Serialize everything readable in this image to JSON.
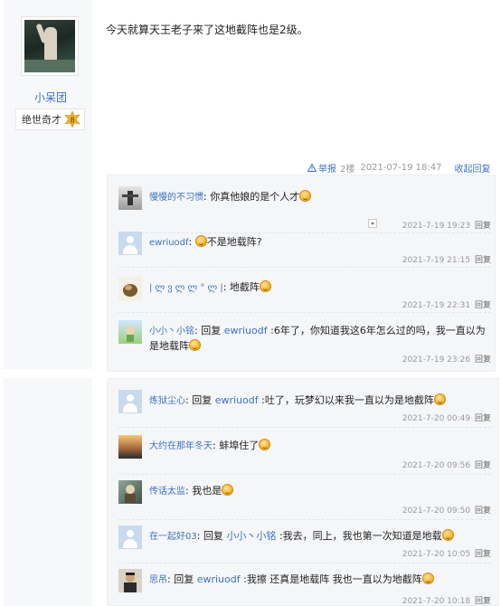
{
  "post": {
    "username": "小呆团",
    "rank_title": "绝世奇才",
    "rank_level": "8",
    "content": "今天就算天王老子来了这地截阵也是2级。",
    "report_label": "举报",
    "floor": "2楼",
    "time": "2021-07-19 18:47",
    "collapse_label": "收起回复"
  },
  "replies_top": [
    {
      "name": "慢慢的不习惯",
      "text": "你真他娘的是个人才",
      "time": "2021-7-19 19:23",
      "reply_label": "回复"
    },
    {
      "name": "ewriuodf",
      "text": "不是地载阵?",
      "time": "2021-7-19 21:15",
      "reply_label": "回复"
    },
    {
      "name": "| ლ ვ ლ ლ ° ლ |",
      "text": "地截阵",
      "time": "2021-7-19 22:31",
      "reply_label": "回复"
    },
    {
      "name": "小小丶小铭",
      "prefix": "回复",
      "ref": "ewriuodf",
      "text": ":6年了，你知道我这6年怎么过的吗，我一直以为是地载阵",
      "time": "2021-7-19 23:26",
      "reply_label": "回复"
    }
  ],
  "replies_bottom": [
    {
      "name": "炼狱尘心",
      "prefix": "回复",
      "ref": "ewriuodf",
      "text": ":吐了，玩梦幻以来我一直以为是地截阵",
      "time": "2021-7-20 00:49",
      "reply_label": "回复"
    },
    {
      "name": "大约在那年冬天",
      "text": "蚌埠住了",
      "time": "2021-7-20 09:56",
      "reply_label": "回复"
    },
    {
      "name": "传话太监",
      "text": "我也是",
      "time": "2021-7-20 09:50",
      "reply_label": "回复"
    },
    {
      "name": "在一起好03",
      "prefix": "回复",
      "ref": "小小丶小铭",
      "text": ":我去，同上，我也第一次知道是地载",
      "time": "2021-7-20 10:05",
      "reply_label": "回复"
    },
    {
      "name": "思吊",
      "prefix": "回复",
      "ref": "ewriuodf",
      "text": ":我擦 还真是地载阵 我也一直以为地截阵",
      "time": "2021-7-20 10:18",
      "reply_label": "回复"
    }
  ]
}
